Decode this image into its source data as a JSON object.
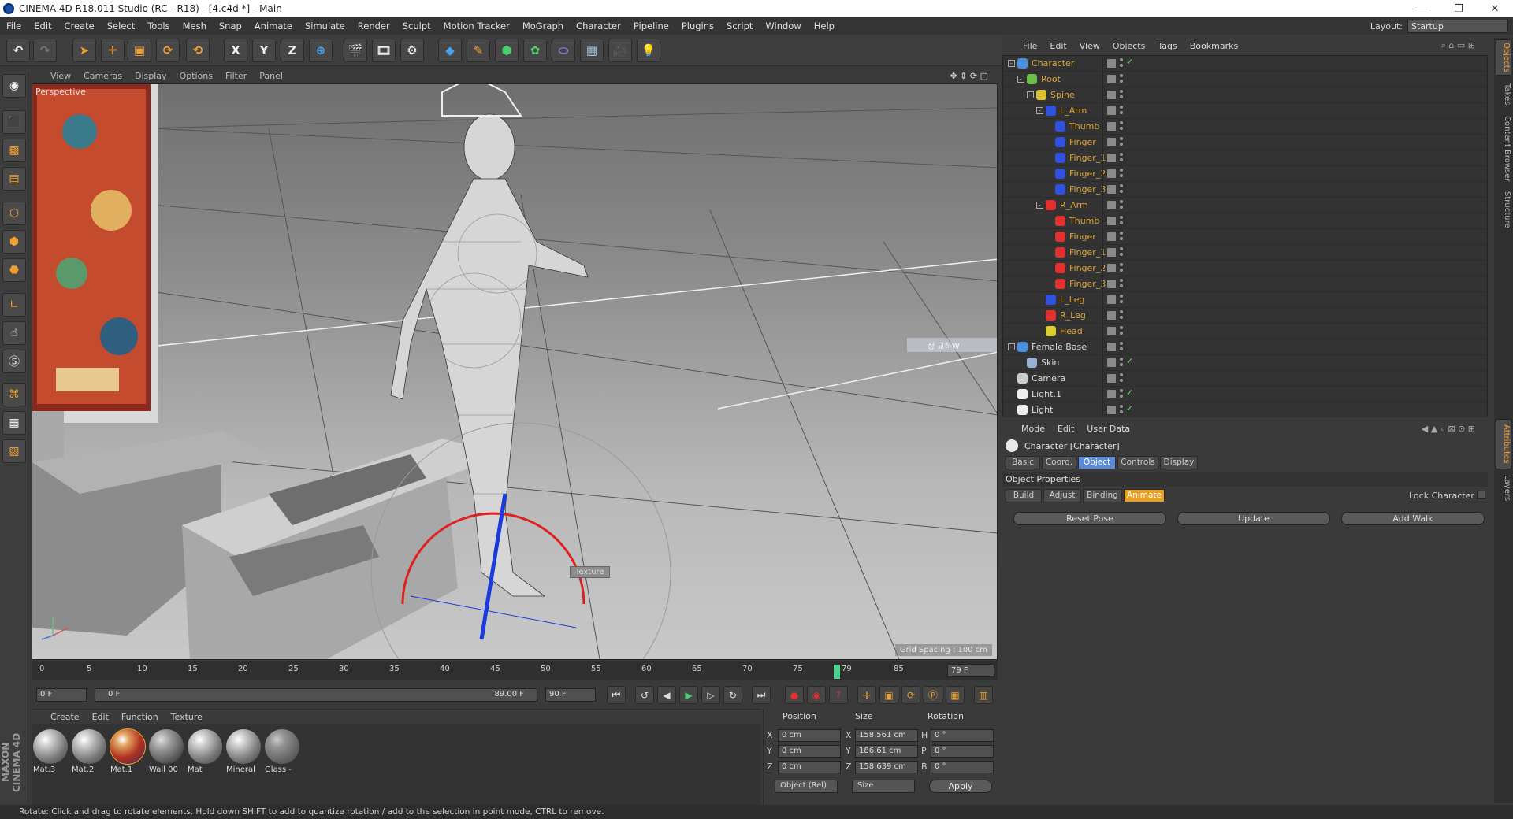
{
  "window": {
    "title": "CINEMA 4D R18.011 Studio (RC - R18) - [4.c4d *] - Main",
    "controls": [
      "—",
      "❐",
      "✕"
    ]
  },
  "menubar": [
    "File",
    "Edit",
    "Create",
    "Select",
    "Tools",
    "Mesh",
    "Snap",
    "Animate",
    "Simulate",
    "Render",
    "Sculpt",
    "Motion Tracker",
    "MoGraph",
    "Character",
    "Pipeline",
    "Plugins",
    "Script",
    "Window",
    "Help"
  ],
  "layout": {
    "label": "Layout:",
    "value": "Startup"
  },
  "toolbar": {
    "axis_x": "X",
    "axis_y": "Y",
    "axis_z": "Z"
  },
  "viewport": {
    "menu": [
      "View",
      "Cameras",
      "Display",
      "Options",
      "Filter",
      "Panel"
    ],
    "label": "Perspective",
    "grid_spacing": "Grid Spacing : 100 cm",
    "texture_tag": "Texture",
    "ghost_label": "장 교하W"
  },
  "timeline": {
    "ticks": [
      "0",
      "5",
      "10",
      "15",
      "20",
      "25",
      "30",
      "35",
      "40",
      "45",
      "50",
      "55",
      "60",
      "65",
      "70",
      "75",
      "79",
      "85"
    ],
    "current_frame": "79 F"
  },
  "transport": {
    "start": "0 F",
    "range_start": "0 F",
    "range_end": "89.00 F",
    "end": "90 F"
  },
  "materials": {
    "menu": [
      "Create",
      "Edit",
      "Function",
      "Texture"
    ],
    "items": [
      "Mat.3",
      "Mat.2",
      "Mat.1",
      "Wall 00",
      "Mat",
      "Mineral",
      "Glass -"
    ]
  },
  "coords": {
    "headers": [
      "Position",
      "Size",
      "Rotation"
    ],
    "rows": [
      {
        "pos_axis": "X",
        "pos": "0 cm",
        "size_axis": "X",
        "size": "158.561 cm",
        "rot_axis": "H",
        "rot": "0 °"
      },
      {
        "pos_axis": "Y",
        "pos": "0 cm",
        "size_axis": "Y",
        "size": "186.61 cm",
        "rot_axis": "P",
        "rot": "0 °"
      },
      {
        "pos_axis": "Z",
        "pos": "0 cm",
        "size_axis": "Z",
        "size": "158.639 cm",
        "rot_axis": "B",
        "rot": "0 °"
      }
    ],
    "mode": "Object (Rel)",
    "size_mode": "Size",
    "apply": "Apply"
  },
  "object_manager": {
    "menu": [
      "File",
      "Edit",
      "View",
      "Objects",
      "Tags",
      "Bookmarks"
    ],
    "rows": [
      {
        "name": "Character",
        "depth": 0,
        "color": "#4a90e0",
        "white": false,
        "check": "✓",
        "tree": "-"
      },
      {
        "name": "Root",
        "depth": 1,
        "color": "#6cc04a",
        "white": false,
        "check": "",
        "tree": "-"
      },
      {
        "name": "Spine",
        "depth": 2,
        "color": "#d8c030",
        "white": false,
        "check": "",
        "tree": "-"
      },
      {
        "name": "L_Arm",
        "depth": 3,
        "color": "#3050e0",
        "white": false,
        "check": "",
        "tree": "-"
      },
      {
        "name": "Thumb",
        "depth": 4,
        "color": "#3050e0",
        "white": false,
        "check": "",
        "tree": ""
      },
      {
        "name": "Finger",
        "depth": 4,
        "color": "#3050e0",
        "white": false,
        "check": "",
        "tree": ""
      },
      {
        "name": "Finger_1",
        "depth": 4,
        "color": "#3050e0",
        "white": false,
        "check": "",
        "tree": ""
      },
      {
        "name": "Finger_2",
        "depth": 4,
        "color": "#3050e0",
        "white": false,
        "check": "",
        "tree": ""
      },
      {
        "name": "Finger_3",
        "depth": 4,
        "color": "#3050e0",
        "white": false,
        "check": "",
        "tree": ""
      },
      {
        "name": "R_Arm",
        "depth": 3,
        "color": "#e03030",
        "white": false,
        "check": "",
        "tree": "-"
      },
      {
        "name": "Thumb",
        "depth": 4,
        "color": "#e03030",
        "white": false,
        "check": "",
        "tree": ""
      },
      {
        "name": "Finger",
        "depth": 4,
        "color": "#e03030",
        "white": false,
        "check": "",
        "tree": ""
      },
      {
        "name": "Finger_1",
        "depth": 4,
        "color": "#e03030",
        "white": false,
        "check": "",
        "tree": ""
      },
      {
        "name": "Finger_2",
        "depth": 4,
        "color": "#e03030",
        "white": false,
        "check": "",
        "tree": ""
      },
      {
        "name": "Finger_3",
        "depth": 4,
        "color": "#e03030",
        "white": false,
        "check": "",
        "tree": ""
      },
      {
        "name": "L_Leg",
        "depth": 3,
        "color": "#3050e0",
        "white": false,
        "check": "",
        "tree": ""
      },
      {
        "name": "R_Leg",
        "depth": 3,
        "color": "#e03030",
        "white": false,
        "check": "",
        "tree": ""
      },
      {
        "name": "Head",
        "depth": 3,
        "color": "#d8d030",
        "white": false,
        "check": "",
        "tree": ""
      },
      {
        "name": "Female Base",
        "depth": 0,
        "color": "#4a90e0",
        "white": true,
        "check": "",
        "tree": "-"
      },
      {
        "name": "Skin",
        "depth": 1,
        "color": "#9ab0d0",
        "white": true,
        "check": "✓",
        "tree": ""
      },
      {
        "name": "Camera",
        "depth": 0,
        "color": "#cccccc",
        "white": true,
        "check": "",
        "tree": ""
      },
      {
        "name": "Light.1",
        "depth": 0,
        "color": "#eeeeee",
        "white": true,
        "check": "✓",
        "tree": ""
      },
      {
        "name": "Light",
        "depth": 0,
        "color": "#eeeeee",
        "white": true,
        "check": "✓",
        "tree": ""
      }
    ]
  },
  "attributes": {
    "menu": [
      "Mode",
      "Edit",
      "User Data"
    ],
    "object_title": "Character [Character]",
    "tabs": [
      "Basic",
      "Coord.",
      "Object",
      "Controls",
      "Display"
    ],
    "section": "Object Properties",
    "subtabs": [
      "Build",
      "Adjust",
      "Binding",
      "Animate"
    ],
    "lock_label": "Lock Character",
    "buttons": [
      "Reset Pose",
      "Update",
      "Add Walk"
    ]
  },
  "right_tabs": [
    "Objects",
    "Takes",
    "Content Browser",
    "Structure",
    "Attributes",
    "Layers"
  ],
  "maxon_logo": "MAXON CINEMA 4D",
  "status": "Rotate: Click and drag to rotate elements. Hold down SHIFT to add to quantize rotation / add to the selection in point mode, CTRL to remove."
}
